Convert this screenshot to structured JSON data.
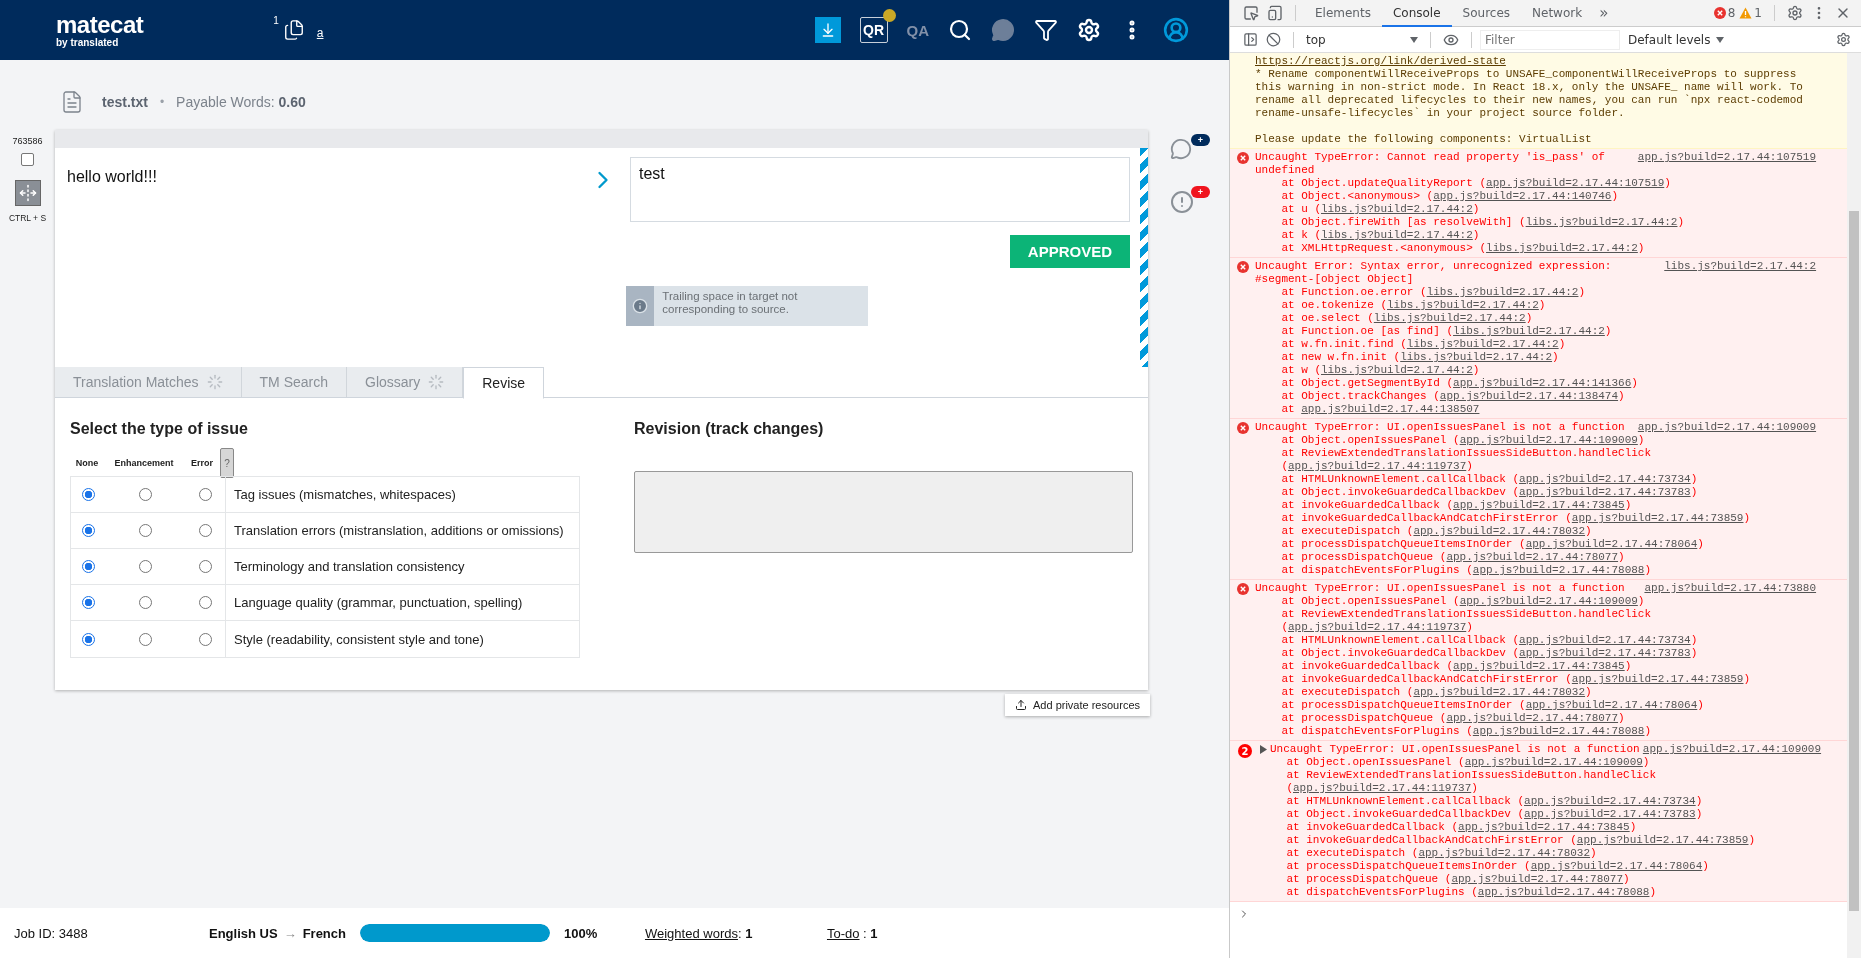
{
  "header": {
    "logo": "matecat",
    "logo_sub": "by translated",
    "job_count": "1",
    "job_link": "a",
    "qr_label": "QR",
    "qr_notification": true,
    "qa_label": "QA"
  },
  "file": {
    "name": "test.txt",
    "separator": "•",
    "payable": "Payable Words: **0.60**"
  },
  "segment": {
    "id": "763586",
    "checked": false,
    "shortcut": "CTRL + S",
    "source": "hello world!!!",
    "target": "test",
    "status": "APPROVED",
    "warning": "Trailing space in target not corresponding to source.",
    "tabs": [
      {
        "label": "Translation Matches",
        "loading": true,
        "selected": false
      },
      {
        "label": "TM Search",
        "loading": false,
        "selected": false
      },
      {
        "label": "Glossary",
        "loading": true,
        "selected": false
      },
      {
        "label": "Revise",
        "loading": false,
        "selected": true
      }
    ],
    "issue_title": "Select the type of issue",
    "columns": [
      "None",
      "Enhancement",
      "Error"
    ],
    "help": "?",
    "issues": [
      {
        "label": "Tag issues (mismatches, whitespaces)",
        "options": [
          {
            "selected": true
          },
          {
            "selected": false
          },
          {
            "selected": false
          }
        ]
      },
      {
        "label": "Translation errors (mistranslation, additions or omissions)",
        "options": [
          {
            "selected": true
          },
          {
            "selected": false
          },
          {
            "selected": false
          }
        ]
      },
      {
        "label": "Terminology and translation consistency",
        "options": [
          {
            "selected": true
          },
          {
            "selected": false
          },
          {
            "selected": false
          }
        ]
      },
      {
        "label": "Language quality (grammar, punctuation, spelling)",
        "options": [
          {
            "selected": true
          },
          {
            "selected": false
          },
          {
            "selected": false
          }
        ]
      },
      {
        "label": "Style (readability, consistent style and tone)",
        "options": [
          {
            "selected": true
          },
          {
            "selected": false
          },
          {
            "selected": false
          }
        ]
      }
    ],
    "revision_title": "Revision (track changes)",
    "comment_badge": "+",
    "issue_badge": "+",
    "resources_button": "Add private resources"
  },
  "footer": {
    "job": "Job ID: 3488",
    "source_lang": "English US",
    "arrow": "→",
    "target_lang": "French",
    "level": 1,
    "percent": "100%",
    "weighted_link": "Weighted words",
    "weighted_rest": ": **1**",
    "todo_link": "To-do",
    "todo_rest": " : **1**"
  },
  "devtools": {
    "tabs": [
      {
        "label": "Elements",
        "selected": false
      },
      {
        "label": "Console",
        "selected": true
      },
      {
        "label": "Sources",
        "selected": false
      },
      {
        "label": "Network",
        "selected": false
      }
    ],
    "more": "»",
    "errors": "8",
    "warnings": "1",
    "context": "top",
    "filter_placeholder": "Filter",
    "levels": "Default levels",
    "messages": [
      {
        "kind": "warning",
        "link": "https://reactjs.org/link/derived-state",
        "paragraphs": [
          "* Rename componentWillReceiveProps to UNSAFE_componentWillReceiveProps to suppress this warning in non-strict mode. In React 18.x, only the UNSAFE_ name will work. To rename all deprecated lifecycles to their new names, you can run `npx react-codemod rename-unsafe-lifecycles` in your project source folder.",
          "Please update the following components: VirtualList"
        ]
      },
      {
        "kind": "error",
        "message": "Uncaught TypeError: Cannot read property 'is_pass' of undefined",
        "source": "app.js?build=2.17.44:107519",
        "frames": [
          {
            "text": "at Object.updateQualityReport (",
            "link": "app.js?build=2.17.44:107519",
            "close": ")"
          },
          {
            "text": "at Object.<anonymous> (",
            "link": "app.js?build=2.17.44:140746",
            "close": ")"
          },
          {
            "text": "at u (",
            "link": "libs.js?build=2.17.44:2",
            "close": ")"
          },
          {
            "text": "at Object.fireWith [as resolveWith] (",
            "link": "libs.js?build=2.17.44:2",
            "close": ")"
          },
          {
            "text": "at k (",
            "link": "libs.js?build=2.17.44:2",
            "close": ")"
          },
          {
            "text": "at XMLHttpRequest.<anonymous> (",
            "link": "libs.js?build=2.17.44:2",
            "close": ")"
          }
        ]
      },
      {
        "kind": "error",
        "message": "Uncaught Error: Syntax error, unrecognized expression: #segment-[object Object]",
        "source": "libs.js?build=2.17.44:2",
        "frames": [
          {
            "text": "at Function.oe.error (",
            "link": "libs.js?build=2.17.44:2",
            "close": ")"
          },
          {
            "text": "at oe.tokenize (",
            "link": "libs.js?build=2.17.44:2",
            "close": ")"
          },
          {
            "text": "at oe.select (",
            "link": "libs.js?build=2.17.44:2",
            "close": ")"
          },
          {
            "text": "at Function.oe [as find] (",
            "link": "libs.js?build=2.17.44:2",
            "close": ")"
          },
          {
            "text": "at w.fn.init.find (",
            "link": "libs.js?build=2.17.44:2",
            "close": ")"
          },
          {
            "text": "at new w.fn.init (",
            "link": "libs.js?build=2.17.44:2",
            "close": ")"
          },
          {
            "text": "at w (",
            "link": "libs.js?build=2.17.44:2",
            "close": ")"
          },
          {
            "text": "at Object.getSegmentById (",
            "link": "app.js?build=2.17.44:141366",
            "close": ")"
          },
          {
            "text": "at Object.trackChanges (",
            "link": "app.js?build=2.17.44:138474",
            "close": ")"
          },
          {
            "text": "at ",
            "link": "app.js?build=2.17.44:138507"
          }
        ]
      },
      {
        "kind": "error",
        "message": "Uncaught TypeError: UI.openIssuesPanel is not a function",
        "source": "app.js?build=2.17.44:109009",
        "frames": [
          {
            "text": "at Object.openIssuesPanel (",
            "link": "app.js?build=2.17.44:109009",
            "close": ")"
          },
          {
            "text": "at ReviewExtendedTranslationIssuesSideButton.handleClick (",
            "link": "app.js?build=2.17.44:119737",
            "close": ")"
          },
          {
            "text": "at HTMLUnknownElement.callCallback (",
            "link": "app.js?build=2.17.44:73734",
            "close": ")"
          },
          {
            "text": "at Object.invokeGuardedCallbackDev (",
            "link": "app.js?build=2.17.44:73783",
            "close": ")"
          },
          {
            "text": "at invokeGuardedCallback (",
            "link": "app.js?build=2.17.44:73845",
            "close": ")"
          },
          {
            "text": "at invokeGuardedCallbackAndCatchFirstError (",
            "link": "app.js?build=2.17.44:73859",
            "close": ")"
          },
          {
            "text": "at executeDispatch (",
            "link": "app.js?build=2.17.44:78032",
            "close": ")"
          },
          {
            "text": "at processDispatchQueueItemsInOrder (",
            "link": "app.js?build=2.17.44:78064",
            "close": ")"
          },
          {
            "text": "at processDispatchQueue (",
            "link": "app.js?build=2.17.44:78077",
            "close": ")"
          },
          {
            "text": "at dispatchEventsForPlugins (",
            "link": "app.js?build=2.17.44:78088",
            "close": ")"
          }
        ]
      },
      {
        "kind": "error",
        "message": "Uncaught TypeError: UI.openIssuesPanel is not a function",
        "source": "app.js?build=2.17.44:73880",
        "frames": [
          {
            "text": "at Object.openIssuesPanel (",
            "link": "app.js?build=2.17.44:109009",
            "close": ")"
          },
          {
            "text": "at ReviewExtendedTranslationIssuesSideButton.handleClick (",
            "link": "app.js?build=2.17.44:119737",
            "close": ")"
          },
          {
            "text": "at HTMLUnknownElement.callCallback (",
            "link": "app.js?build=2.17.44:73734",
            "close": ")"
          },
          {
            "text": "at Object.invokeGuardedCallbackDev (",
            "link": "app.js?build=2.17.44:73783",
            "close": ")"
          },
          {
            "text": "at invokeGuardedCallback (",
            "link": "app.js?build=2.17.44:73845",
            "close": ")"
          },
          {
            "text": "at invokeGuardedCallbackAndCatchFirstError (",
            "link": "app.js?build=2.17.44:73859",
            "close": ")"
          },
          {
            "text": "at executeDispatch (",
            "link": "app.js?build=2.17.44:78032",
            "close": ")"
          },
          {
            "text": "at processDispatchQueueItemsInOrder (",
            "link": "app.js?build=2.17.44:78064",
            "close": ")"
          },
          {
            "text": "at processDispatchQueue (",
            "link": "app.js?build=2.17.44:78077",
            "close": ")"
          },
          {
            "text": "at dispatchEventsForPlugins (",
            "link": "app.js?build=2.17.44:78088",
            "close": ")"
          }
        ]
      },
      {
        "kind": "error",
        "count": "2",
        "message": "Uncaught TypeError: UI.openIssuesPanel is not a function",
        "source": "app.js?build=2.17.44:109009",
        "frames": [
          {
            "text": "at Object.openIssuesPanel (",
            "link": "app.js?build=2.17.44:109009",
            "close": ")"
          },
          {
            "text": "at ReviewExtendedTranslationIssuesSideButton.handleClick (",
            "link": "app.js?build=2.17.44:119737",
            "close": ")"
          },
          {
            "text": "at HTMLUnknownElement.callCallback (",
            "link": "app.js?build=2.17.44:73734",
            "close": ")"
          },
          {
            "text": "at Object.invokeGuardedCallbackDev (",
            "link": "app.js?build=2.17.44:73783",
            "close": ")"
          },
          {
            "text": "at invokeGuardedCallback (",
            "link": "app.js?build=2.17.44:73845",
            "close": ")"
          },
          {
            "text": "at invokeGuardedCallbackAndCatchFirstError (",
            "link": "app.js?build=2.17.44:73859",
            "close": ")"
          },
          {
            "text": "at executeDispatch (",
            "link": "app.js?build=2.17.44:78032",
            "close": ")"
          },
          {
            "text": "at processDispatchQueueItemsInOrder (",
            "link": "app.js?build=2.17.44:78064",
            "close": ")"
          },
          {
            "text": "at processDispatchQueue (",
            "link": "app.js?build=2.17.44:78077",
            "close": ")"
          },
          {
            "text": "at dispatchEventsForPlugins (",
            "link": "app.js?build=2.17.44:78088",
            "close": ")"
          }
        ]
      }
    ]
  }
}
